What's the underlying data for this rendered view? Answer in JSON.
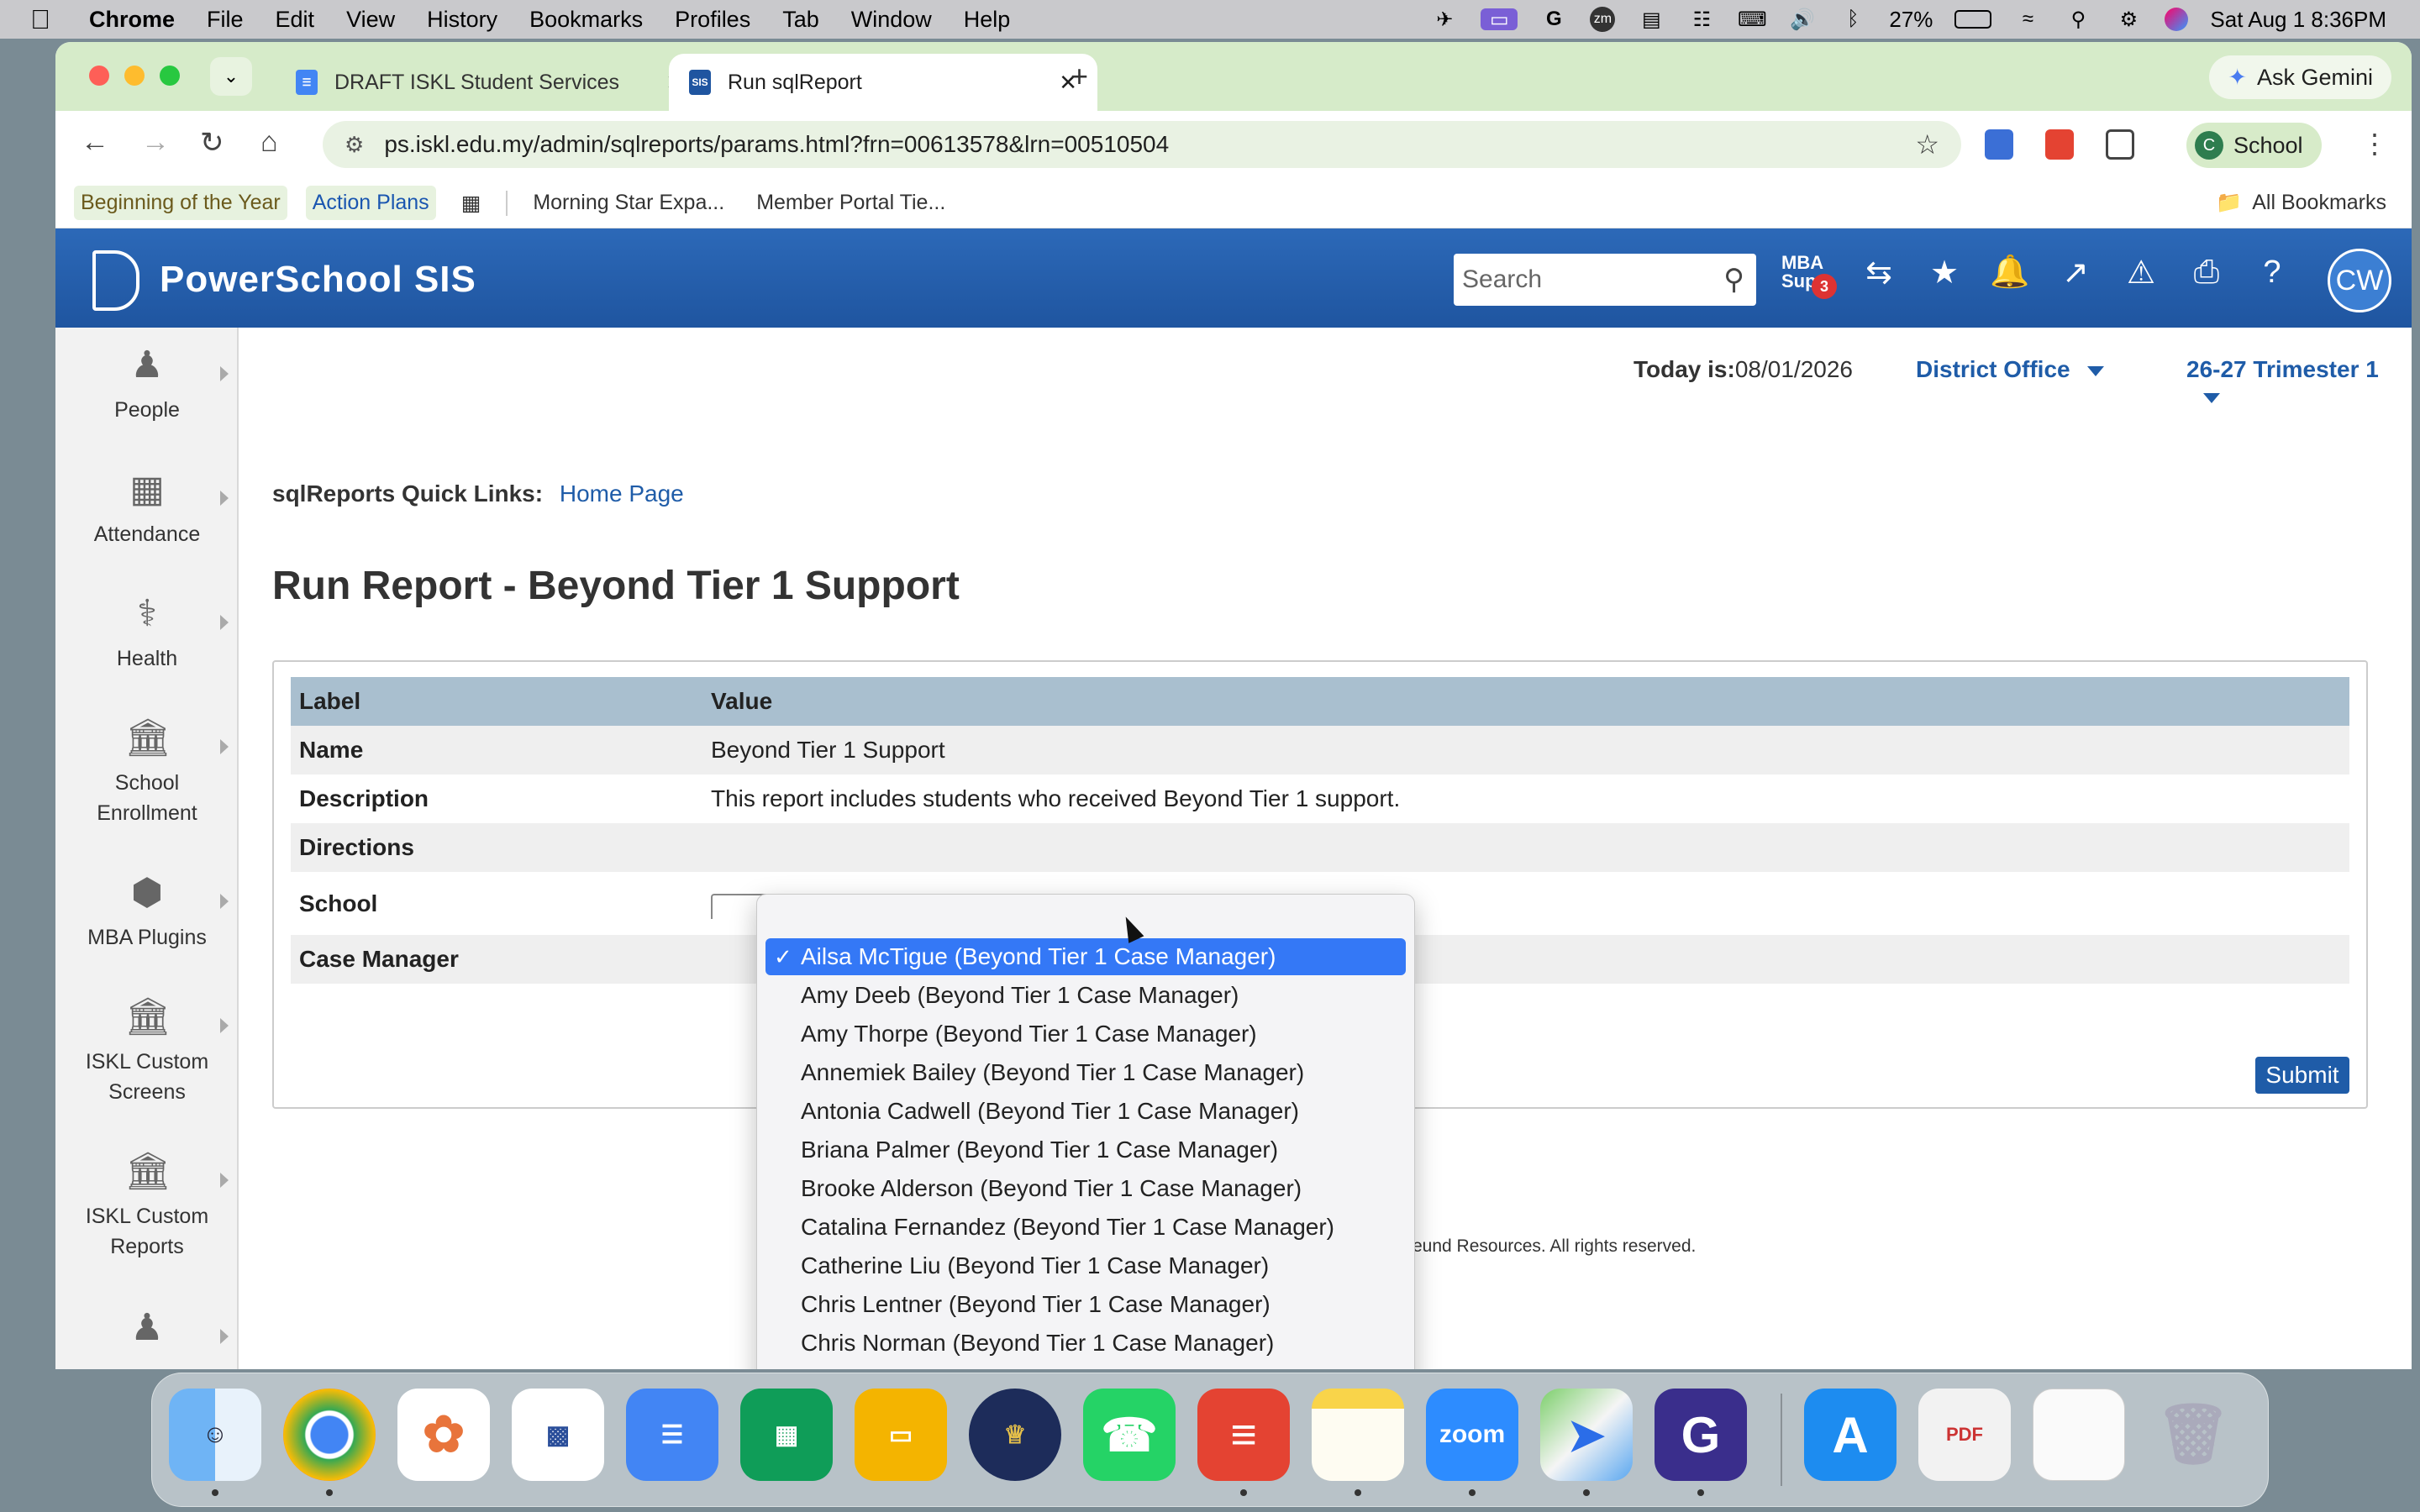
{
  "menubar": {
    "app": "Chrome",
    "items": [
      "File",
      "Edit",
      "View",
      "History",
      "Bookmarks",
      "Profiles",
      "Tab",
      "Window",
      "Help"
    ],
    "battery": "27%",
    "datetime": "Sat Aug 1  8:36PM"
  },
  "tabs": [
    {
      "title": "DRAFT ISKL Student Services"
    },
    {
      "title": "Run sqlReport"
    }
  ],
  "gemini_label": "Ask Gemini",
  "url": "ps.iskl.edu.my/admin/sqlreports/params.html?frn=00613578&lrn=00510504",
  "profile": {
    "initial": "C",
    "label": "School"
  },
  "bookmarks": [
    {
      "label": "Beginning of the Year"
    },
    {
      "label": "Action Plans"
    },
    {
      "label": "Morning Star Expa..."
    },
    {
      "label": "Member Portal Tie..."
    }
  ],
  "all_bookmarks": "All Bookmarks",
  "ps": {
    "title": "PowerSchool SIS",
    "search_placeholder": "Search",
    "mba_label": "MBA Supp",
    "mba_badge": "3",
    "avatar": "CW"
  },
  "leftnav": [
    {
      "label": "People"
    },
    {
      "label": "Attendance"
    },
    {
      "label": "Health"
    },
    {
      "label": "School Enrollment"
    },
    {
      "label": "MBA Plugins"
    },
    {
      "label": "ISKL Custom Screens"
    },
    {
      "label": "ISKL Custom Reports"
    }
  ],
  "today_label": "Today is:",
  "today_value": "08/01/2026",
  "school_selector": "District Office",
  "term_selector": "26-27 Trimester 1",
  "quicklinks_label": "sqlReports Quick Links:",
  "quicklinks_link": "Home Page",
  "page_title": "Run Report - Beyond Tier 1 Support",
  "table": {
    "headers": [
      "Label",
      "Value"
    ],
    "rows": [
      {
        "label": "Name",
        "value": "Beyond Tier 1 Support"
      },
      {
        "label": "Description",
        "value": "This report includes students who received Beyond Tier 1 support."
      },
      {
        "label": "Directions",
        "value": ""
      },
      {
        "label": "School",
        "value": ""
      },
      {
        "label": "Case Manager",
        "value": ""
      }
    ]
  },
  "submit_label": "Submit",
  "copyright": "reund Resources. All rights reserved.",
  "dropdown": {
    "options": [
      "Ailsa McTigue (Beyond Tier 1 Case Manager)",
      "Amy Deeb (Beyond Tier 1 Case Manager)",
      "Amy Thorpe (Beyond Tier 1 Case Manager)",
      "Annemiek Bailey (Beyond Tier 1 Case Manager)",
      "Antonia Cadwell (Beyond Tier 1 Case Manager)",
      "Briana Palmer (Beyond Tier 1 Case Manager)",
      "Brooke Alderson (Beyond Tier 1 Case Manager)",
      "Catalina Fernandez (Beyond Tier 1 Case Manager)",
      "Catherine Liu (Beyond Tier 1 Case Manager)",
      "Chris Lentner (Beyond Tier 1 Case Manager)",
      "Chris Norman (Beyond Tier 1 Case Manager)"
    ],
    "selected_index": 0
  },
  "dock_zoom_label": "zoom"
}
